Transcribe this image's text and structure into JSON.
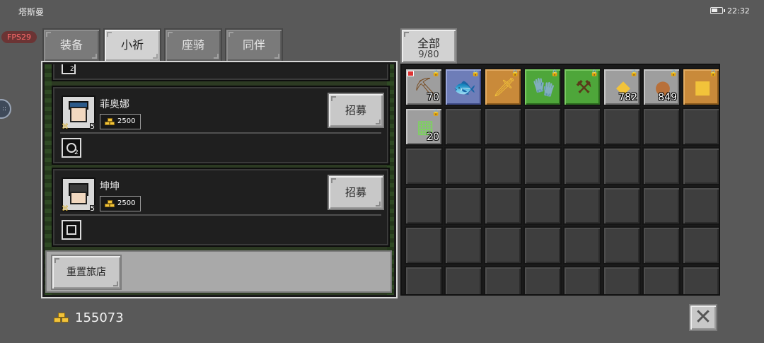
{
  "status": {
    "location": "塔斯曼",
    "clock": "22:32",
    "fps": "FPS29"
  },
  "tabs": [
    "装备",
    "小祈",
    "座骑",
    "同伴"
  ],
  "active_tab": "小祈",
  "tavern": {
    "top_partial_count": "2",
    "recruits": [
      {
        "name": "菲奥娜",
        "level": "5",
        "price": "2500",
        "button": "招募",
        "skill_count": "2"
      },
      {
        "name": "坤坤",
        "level": "5",
        "price": "2500",
        "button": "招募",
        "skill_count": ""
      }
    ],
    "reset_label": "重置旅店"
  },
  "inventory": {
    "filter_label": "全部",
    "capacity": "9/80",
    "items": [
      {
        "icon": "shovel-icon",
        "rarity": "gray",
        "count": "70",
        "locked": true,
        "new": true
      },
      {
        "icon": "fish-icon",
        "rarity": "blue",
        "count": "",
        "locked": true,
        "new": false
      },
      {
        "icon": "sword-icon",
        "rarity": "orange",
        "count": "",
        "locked": true,
        "new": false
      },
      {
        "icon": "gauntlet-icon",
        "rarity": "green",
        "count": "",
        "locked": true,
        "new": false
      },
      {
        "icon": "pickaxe-icon",
        "rarity": "green",
        "count": "",
        "locked": true,
        "new": false
      },
      {
        "icon": "ore-icon",
        "rarity": "gray",
        "count": "782",
        "locked": true,
        "new": false
      },
      {
        "icon": "meat-icon",
        "rarity": "gray",
        "count": "849",
        "locked": true,
        "new": false
      },
      {
        "icon": "gold-block-icon",
        "rarity": "orange",
        "count": "",
        "locked": true,
        "new": false
      },
      {
        "icon": "armor-icon",
        "rarity": "gray",
        "count": "20",
        "locked": true,
        "new": false
      }
    ]
  },
  "money": "155073",
  "colors": {
    "gold": "#f2c33a",
    "panel": "#1a1a1a",
    "background": "#595959"
  }
}
